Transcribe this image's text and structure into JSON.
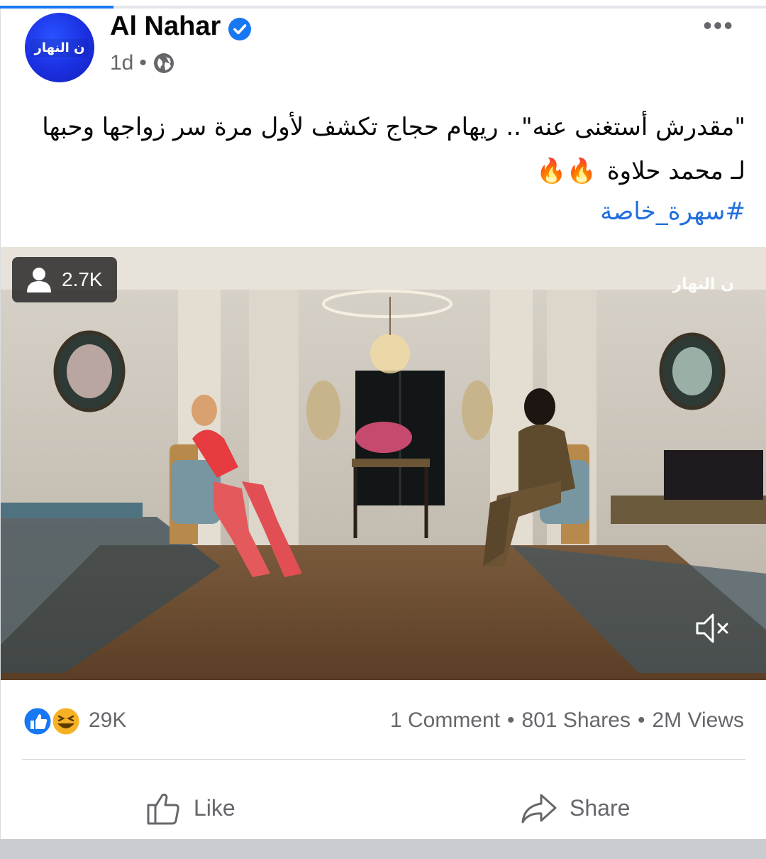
{
  "post": {
    "page_name": "Al Nahar",
    "time": "1d",
    "meta_separator": "•",
    "more_label": "•••",
    "avatar_logo_text": "ن النهار",
    "caption_line1": "\"مقدرش أستغنى عنه\".. ريهام حجاج تكشف لأول مرة سر زواجها وحبها",
    "caption_line2": "لـ محمد حلاوة",
    "caption_emojis": "🔥🔥",
    "hashtag": "#سهرة_خاصة"
  },
  "video": {
    "viewer_count": "2.7K",
    "watermark": "ن النهار"
  },
  "engagement": {
    "reaction_count": "29K",
    "comments": "1 Comment",
    "shares": "801 Shares",
    "views": "2M Views",
    "separator": "•"
  },
  "actions": {
    "like_label": "Like",
    "share_label": "Share"
  },
  "colors": {
    "brand_blue": "#1877f2",
    "hashtag_blue": "#216fdb",
    "secondary_text": "#65676b",
    "haha_yellow": "#f7b125"
  }
}
